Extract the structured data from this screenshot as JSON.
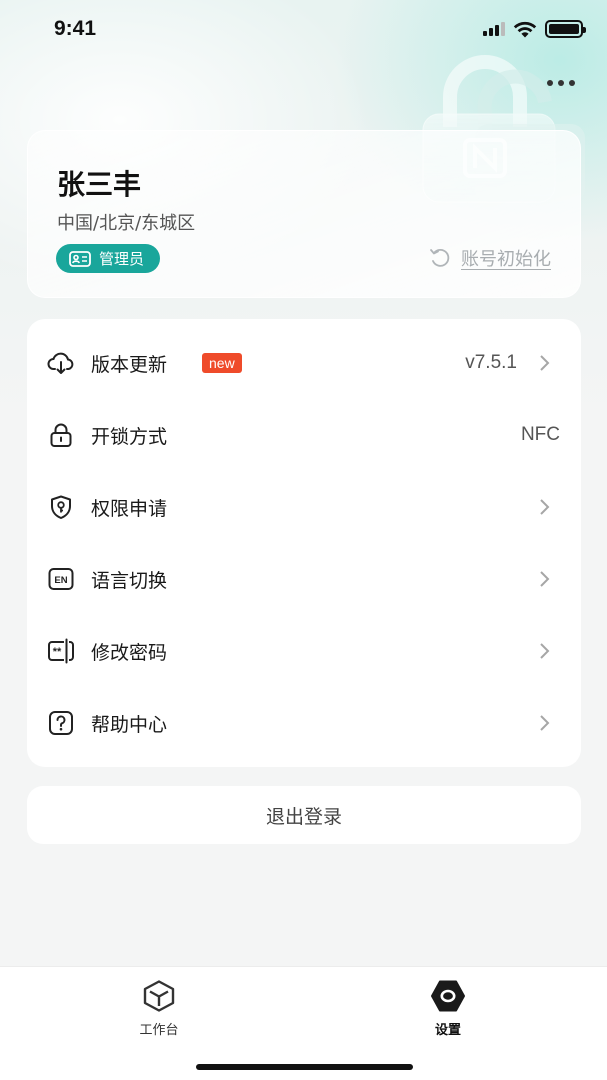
{
  "status_bar": {
    "time": "9:41",
    "icons": [
      "signal-icon",
      "wifi-icon",
      "battery-icon"
    ]
  },
  "header": {
    "more_icon": "more-icon"
  },
  "profile": {
    "name": "张三丰",
    "location": "中国/北京/东城区",
    "role": "管理员",
    "role_icon": "id-card-icon",
    "reset_label": "账号初始化",
    "reset_icon": "refresh-icon"
  },
  "settings": {
    "items": [
      {
        "label": "版本更新",
        "icon": "cloud-download-icon",
        "badge": "new",
        "value": "v7.5.1",
        "has_arrow": true
      },
      {
        "label": "开锁方式",
        "icon": "lock-icon",
        "badge": "",
        "value": "NFC",
        "has_arrow": false
      },
      {
        "label": "权限申请",
        "icon": "shield-key-icon",
        "badge": "",
        "value": "",
        "has_arrow": true
      },
      {
        "label": "语言切换",
        "icon": "language-en-icon",
        "badge": "",
        "value": "",
        "has_arrow": true
      },
      {
        "label": "修改密码",
        "icon": "password-icon",
        "badge": "",
        "value": "",
        "has_arrow": true
      },
      {
        "label": "帮助中心",
        "icon": "help-icon",
        "badge": "",
        "value": "",
        "has_arrow": true
      }
    ]
  },
  "logout_label": "退出登录",
  "tab_bar": {
    "tabs": [
      {
        "label": "工作台",
        "icon": "workbench-icon",
        "active": false
      },
      {
        "label": "设置",
        "icon": "settings-icon",
        "active": true
      }
    ]
  },
  "colors": {
    "accent": "#19a69b",
    "new_badge": "#ef4b2a",
    "background": "#f4f5f5"
  }
}
